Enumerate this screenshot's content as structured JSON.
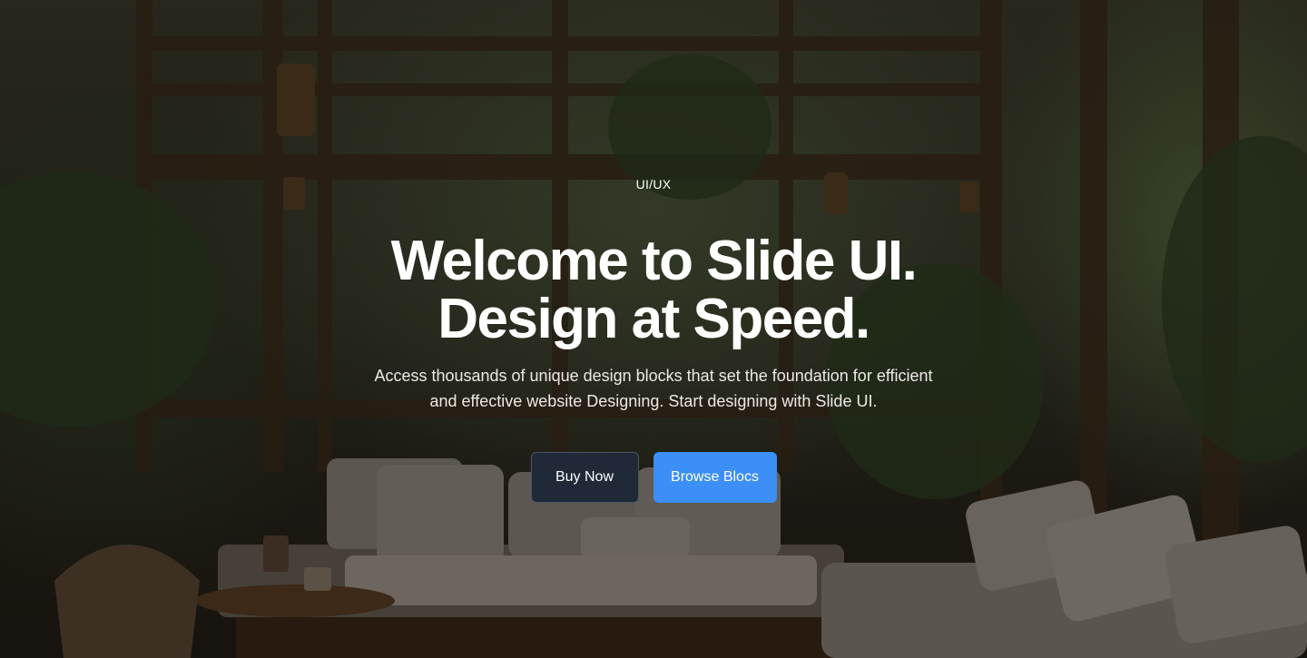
{
  "hero": {
    "eyebrow": "UI/UX",
    "headline_line1": "Welcome to Slide UI.",
    "headline_line2": "Design at Speed.",
    "subtext": "Access thousands of unique design blocks that set the foundation for efficient and effective website Designing. Start designing with Slide UI.",
    "buttons": {
      "buy_now": "Buy Now",
      "browse_blocs": "Browse Blocs"
    }
  },
  "colors": {
    "primary_button": "#3b8ff6",
    "dark_button": "#1f2937",
    "text": "#ffffff"
  }
}
